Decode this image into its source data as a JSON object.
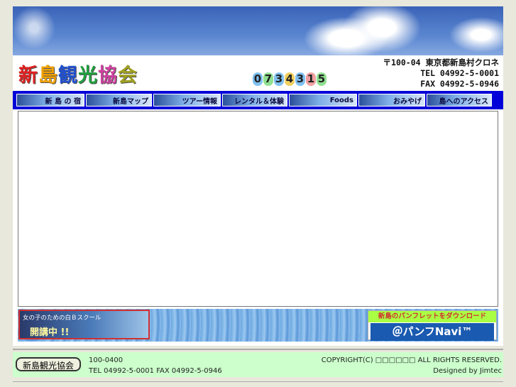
{
  "header": {
    "logo_chars": [
      "新",
      "島",
      "観",
      "光",
      "協",
      "会"
    ],
    "logo_colors": [
      "#e02020",
      "#f0a000",
      "#2050d0",
      "#20a040",
      "#d040a0",
      "#a0a020"
    ],
    "phone_digits": [
      "0",
      "7",
      "3",
      "4",
      "3",
      "1",
      "5"
    ],
    "phone_digit_colors": [
      "#80c0f0",
      "#90e090",
      "#80c0f0",
      "#f0d060",
      "#80c0f0",
      "#f0a0a0",
      "#90e090"
    ],
    "address": "〒100-04 東京都新島村クロネ",
    "tel": "TEL 04992-5-0001",
    "fax": "FAX 04992-5-0946"
  },
  "nav": {
    "items": [
      {
        "label": "新 島 の 宿",
        "icon": "house-icon"
      },
      {
        "label": "新島マップ",
        "icon": "building-icon"
      },
      {
        "label": "ツアー情報",
        "icon": "wave-icon"
      },
      {
        "label": "レンタル＆体験",
        "icon": "person-icon"
      },
      {
        "label": "Foods",
        "icon": "food-icon"
      },
      {
        "label": "おみやげ",
        "icon": "gift-icon"
      },
      {
        "label": "島へのアクセス",
        "icon": "plane-icon"
      }
    ]
  },
  "banners": {
    "left_sub": "女の子のための白Ｂスクール",
    "left_main": "開講中 !!",
    "right_top": "新島のパンフレットをダウンロード",
    "right_bottom": "＠パンフNavi™"
  },
  "footer": {
    "logo": "新島観光協会",
    "postal": "100-0400",
    "contact": "TEL 04992-5-0001 FAX 04992-5-0946",
    "copyright": "COPYRIGHT(C) □□□□□□ ALL RIGHTS RESERVED.",
    "designed": "Designed by Jimtec"
  }
}
